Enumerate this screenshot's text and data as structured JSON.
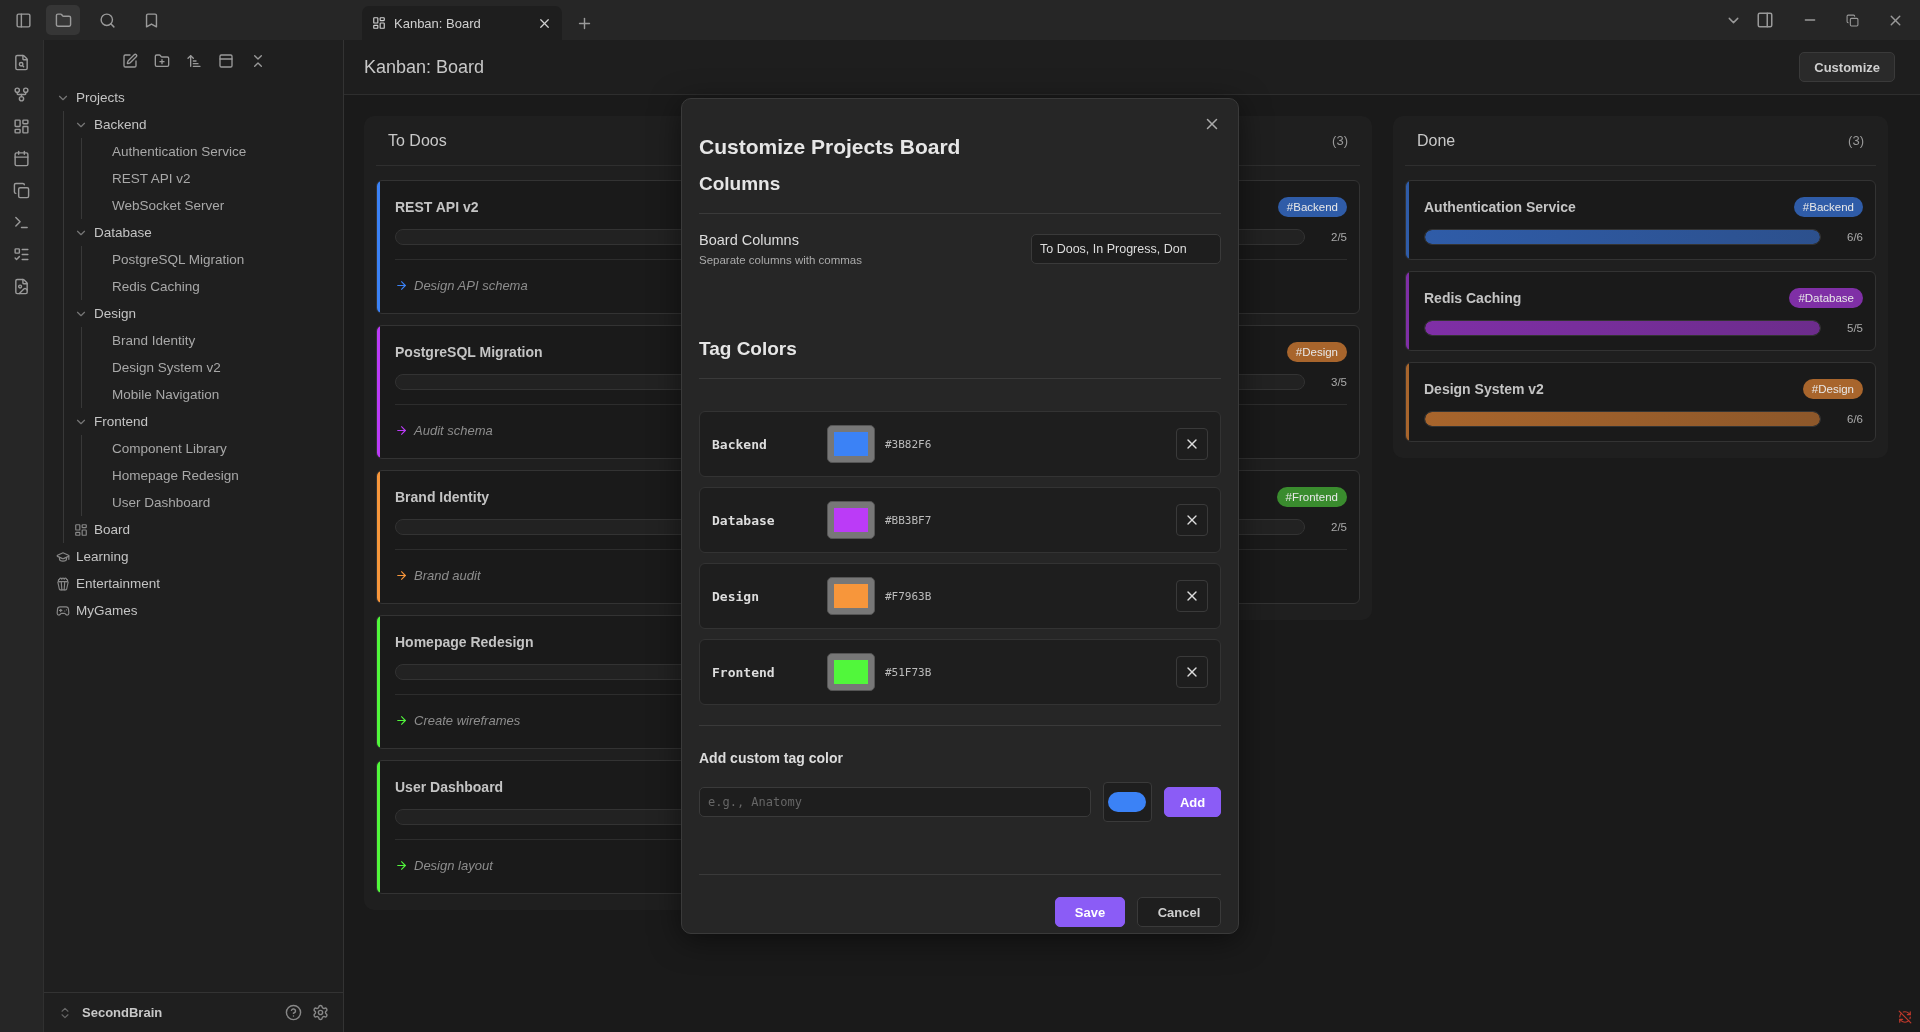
{
  "titlebar": {
    "nav": [
      {
        "kind": "files",
        "selected": true
      },
      {
        "kind": "search",
        "selected": false
      },
      {
        "kind": "bookmarks",
        "selected": false
      }
    ],
    "tabs": [
      {
        "title": "Kanban: Board",
        "selected": true
      }
    ]
  },
  "sidebar": {
    "tree": [
      {
        "label": "Projects",
        "kind": "folder",
        "expanded": true,
        "children": [
          {
            "label": "Backend",
            "kind": "folder",
            "expanded": true,
            "children": [
              {
                "label": "Authentication Service",
                "kind": "file"
              },
              {
                "label": "REST API v2",
                "kind": "file"
              },
              {
                "label": "WebSocket Server",
                "kind": "file"
              }
            ]
          },
          {
            "label": "Database",
            "kind": "folder",
            "expanded": true,
            "children": [
              {
                "label": "PostgreSQL Migration",
                "kind": "file"
              },
              {
                "label": "Redis Caching",
                "kind": "file"
              }
            ]
          },
          {
            "label": "Design",
            "kind": "folder",
            "expanded": true,
            "children": [
              {
                "label": "Brand Identity",
                "kind": "file"
              },
              {
                "label": "Design System v2",
                "kind": "file"
              },
              {
                "label": "Mobile Navigation",
                "kind": "file"
              }
            ]
          },
          {
            "label": "Frontend",
            "kind": "folder",
            "expanded": true,
            "children": [
              {
                "label": "Component Library",
                "kind": "file"
              },
              {
                "label": "Homepage Redesign",
                "kind": "file"
              },
              {
                "label": "User Dashboard",
                "kind": "file"
              }
            ]
          },
          {
            "label": "Board",
            "kind": "board"
          }
        ]
      },
      {
        "label": "Learning",
        "kind": "cap"
      },
      {
        "label": "Entertainment",
        "kind": "bucket"
      },
      {
        "label": "MyGames",
        "kind": "gamepad"
      }
    ],
    "vault": "SecondBrain"
  },
  "view": {
    "title": "Kanban: Board",
    "action": "Customize"
  },
  "board": {
    "columns": [
      {
        "title": "To Doos",
        "cards": [
          {
            "kind": "open",
            "title": "REST API v2",
            "color": "#3b82f6",
            "next": "Design API schema"
          },
          {
            "kind": "open",
            "title": "PostgreSQL Migration",
            "color": "#bb3bf7",
            "next": "Audit schema"
          },
          {
            "kind": "open",
            "title": "Brand Identity",
            "color": "#f7963b",
            "next": "Brand audit"
          },
          {
            "kind": "open",
            "title": "Homepage Redesign",
            "color": "#51f73b",
            "next": "Create wireframes"
          },
          {
            "kind": "open",
            "title": "User Dashboard",
            "color": "#51f73b",
            "next": "Design layout"
          }
        ]
      },
      {
        "count": "(3)",
        "cards": [
          {
            "kind": "open",
            "tag": "#Backend",
            "color": "#2f5ca8",
            "count": "2/5"
          },
          {
            "kind": "open",
            "tag": "#Design",
            "color": "#a8652c",
            "count": "3/5"
          },
          {
            "kind": "open",
            "tag": "#Frontend",
            "color": "#3a8c2e",
            "count": "2/5"
          }
        ]
      },
      {
        "title": "Done",
        "count": "(3)",
        "cards": [
          {
            "kind": "done",
            "title": "Authentication Service",
            "tag": "#Backend",
            "color": "#2f5ca8",
            "level": 1,
            "count": "6/6"
          },
          {
            "kind": "done",
            "title": "Redis Caching",
            "tag": "#Database",
            "color": "#7f2fa6",
            "level": 1,
            "count": "5/5"
          },
          {
            "kind": "done",
            "title": "Design System v2",
            "tag": "#Design",
            "color": "#a8652c",
            "level": 1,
            "count": "6/6"
          }
        ]
      }
    ]
  },
  "modal": {
    "title": "Customize Projects Board",
    "columns_heading": "Columns",
    "board_columns": {
      "label": "Board Columns",
      "description": "Separate columns with commas",
      "value": "To Doos, In Progress, Don"
    },
    "tags_heading": "Tag Colors",
    "tags": [
      {
        "name": "Backend",
        "color": "#3b82f6",
        "hex": "#3B82F6"
      },
      {
        "name": "Database",
        "color": "#bb3bf7",
        "hex": "#BB3BF7"
      },
      {
        "name": "Design",
        "color": "#f7963b",
        "hex": "#F7963B"
      },
      {
        "name": "Frontend",
        "color": "#51f73b",
        "hex": "#51F73B"
      }
    ],
    "add_heading": "Add custom tag color",
    "add_placeholder": "e.g., Anatomy",
    "add_picker": {
      "color": "#3b82f6"
    },
    "add_button": "Add",
    "save": "Save",
    "cancel": "Cancel"
  }
}
